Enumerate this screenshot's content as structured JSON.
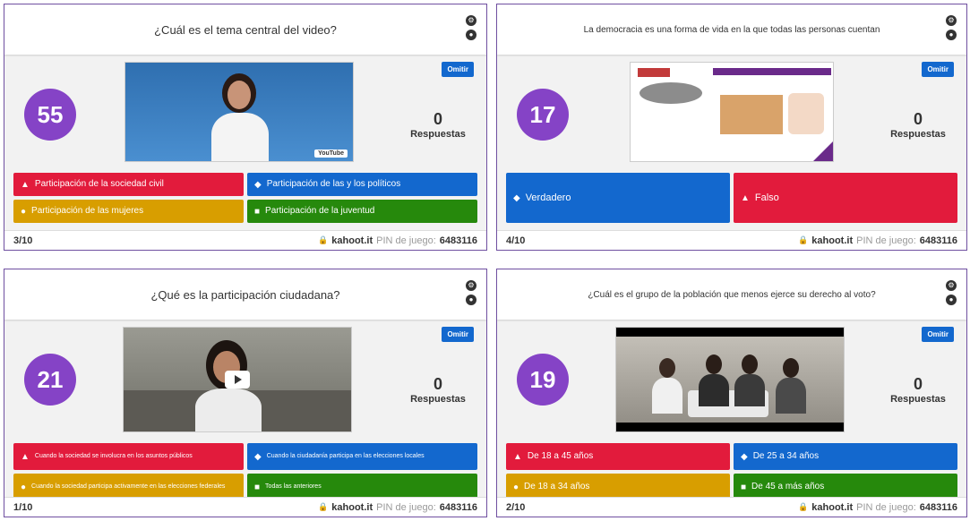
{
  "panels": [
    {
      "question": "¿Cuál es el tema central del video?",
      "timer": "55",
      "skip_label": "Omitir",
      "answers_count": "0",
      "answers_label": "Respuestas",
      "counter": "3/10",
      "domain": "kahoot.it",
      "pin_label": "PIN de juego:",
      "pin": "6483116",
      "video_badge": "YouTube",
      "answers": [
        {
          "icon": "▲",
          "icon_name": "triangle-icon",
          "color": "#e21b3c",
          "label": "Participación de la sociedad civil"
        },
        {
          "icon": "◆",
          "icon_name": "diamond-icon",
          "color": "#1368ce",
          "label": "Participación de las y los políticos"
        },
        {
          "icon": "●",
          "icon_name": "circle-icon",
          "color": "#d89e00",
          "label": "Participación de las mujeres"
        },
        {
          "icon": "■",
          "icon_name": "square-icon",
          "color": "#26890c",
          "label": "Participación de la juventud"
        }
      ]
    },
    {
      "question": "La democracia es una forma de vida en la que todas las personas cuentan",
      "timer": "17",
      "skip_label": "Omitir",
      "answers_count": "0",
      "answers_label": "Respuestas",
      "counter": "4/10",
      "domain": "kahoot.it",
      "pin_label": "PIN de juego:",
      "pin": "6483116",
      "answers": [
        {
          "icon": "◆",
          "icon_name": "diamond-icon",
          "color": "#1368ce",
          "label": "Verdadero"
        },
        {
          "icon": "▲",
          "icon_name": "triangle-icon",
          "color": "#e21b3c",
          "label": "Falso"
        }
      ]
    },
    {
      "question": "¿Qué es la participación ciudadana?",
      "timer": "21",
      "skip_label": "Omitir",
      "answers_count": "0",
      "answers_label": "Respuestas",
      "counter": "1/10",
      "domain": "kahoot.it",
      "pin_label": "PIN de juego:",
      "pin": "6483116",
      "answers": [
        {
          "icon": "▲",
          "icon_name": "triangle-icon",
          "color": "#e21b3c",
          "label": "Cuando la sociedad se involucra en los asuntos públicos"
        },
        {
          "icon": "◆",
          "icon_name": "diamond-icon",
          "color": "#1368ce",
          "label": "Cuando la ciudadanía participa en las elecciones locales"
        },
        {
          "icon": "●",
          "icon_name": "circle-icon",
          "color": "#d89e00",
          "label": "Cuando la sociedad participa activamente en las elecciones federales"
        },
        {
          "icon": "■",
          "icon_name": "square-icon",
          "color": "#26890c",
          "label": "Todas las anteriores"
        }
      ]
    },
    {
      "question": "¿Cuál es el grupo de la población que menos ejerce su derecho al voto?",
      "timer": "19",
      "skip_label": "Omitir",
      "answers_count": "0",
      "answers_label": "Respuestas",
      "counter": "2/10",
      "domain": "kahoot.it",
      "pin_label": "PIN de juego:",
      "pin": "6483116",
      "answers": [
        {
          "icon": "▲",
          "icon_name": "triangle-icon",
          "color": "#e21b3c",
          "label": "De 18 a 45 años"
        },
        {
          "icon": "◆",
          "icon_name": "diamond-icon",
          "color": "#1368ce",
          "label": "De 25 a 34 años"
        },
        {
          "icon": "●",
          "icon_name": "circle-icon",
          "color": "#d89e00",
          "label": "De 18 a 34 años"
        },
        {
          "icon": "■",
          "icon_name": "square-icon",
          "color": "#26890c",
          "label": "De 45 a más años"
        }
      ]
    }
  ]
}
